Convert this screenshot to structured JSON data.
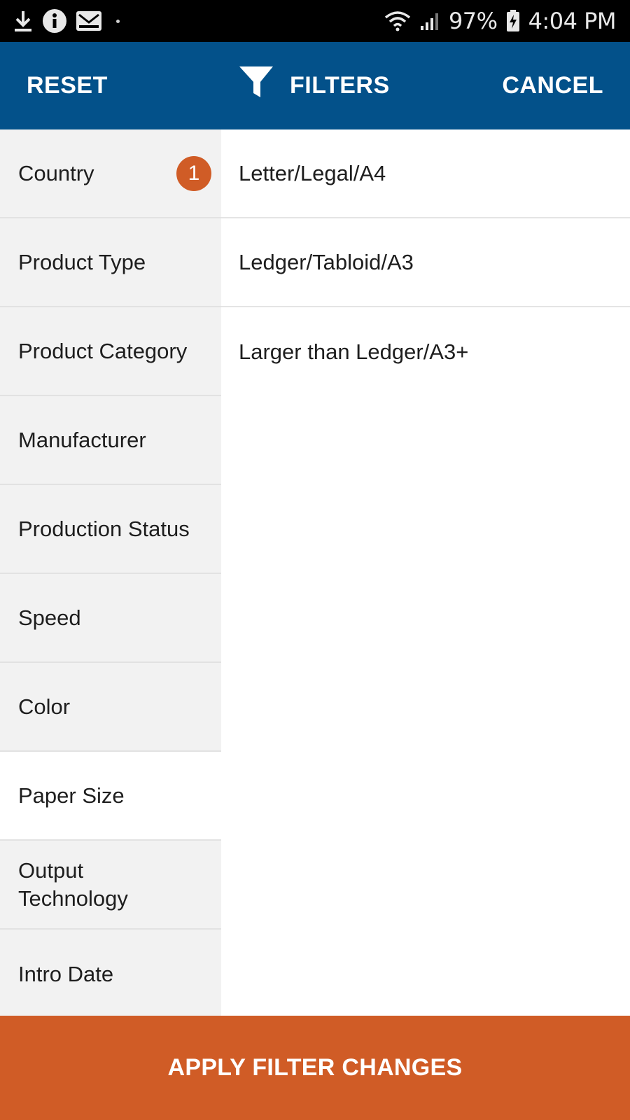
{
  "status_bar": {
    "icons_left": [
      "download-icon",
      "info-icon",
      "mail-icon"
    ],
    "battery": "97%",
    "time": "4:04 PM",
    "icons_right": [
      "wifi-icon",
      "signal-icon",
      "battery-charging-icon"
    ]
  },
  "header": {
    "reset_label": "RESET",
    "title": "FILTERS",
    "title_icon": "filter-icon",
    "cancel_label": "CANCEL",
    "background": "#03518a"
  },
  "categories": [
    {
      "label": "Country",
      "badge": "1"
    },
    {
      "label": "Product Type"
    },
    {
      "label": "Product Category"
    },
    {
      "label": "Manufacturer"
    },
    {
      "label": "Production Status"
    },
    {
      "label": "Speed"
    },
    {
      "label": "Color"
    },
    {
      "label": "Paper Size",
      "selected": true
    },
    {
      "label": "Output Technology"
    },
    {
      "label": "Intro Date"
    }
  ],
  "options": [
    {
      "label": "Letter/Legal/A4"
    },
    {
      "label": "Ledger/Tabloid/A3"
    },
    {
      "label": "Larger than Ledger/A3+"
    }
  ],
  "apply_button": {
    "label": "APPLY FILTER CHANGES",
    "background": "#d05c26"
  },
  "colors": {
    "accent": "#d05c26",
    "primary": "#03518a"
  }
}
